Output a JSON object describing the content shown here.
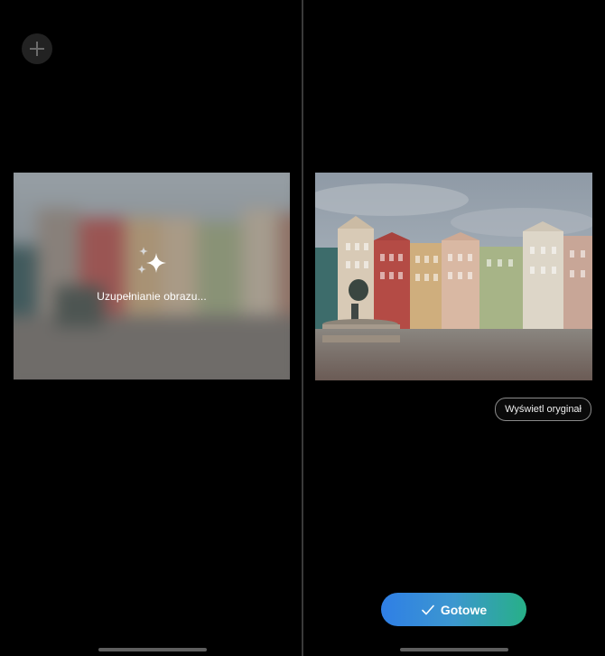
{
  "left_panel": {
    "add_icon": "plus-icon",
    "progress_icon": "sparkle-icon",
    "progress_text": "Uzupełnianie obrazu..."
  },
  "right_panel": {
    "view_original_label": "Wyświetl oryginał",
    "done_label": "Gotowe",
    "done_icon": "checkmark-icon",
    "done_gradient": [
      "#2f7fe6",
      "#27b087"
    ]
  },
  "colors": {
    "background": "#000000",
    "divider": "#3a3a3a"
  }
}
